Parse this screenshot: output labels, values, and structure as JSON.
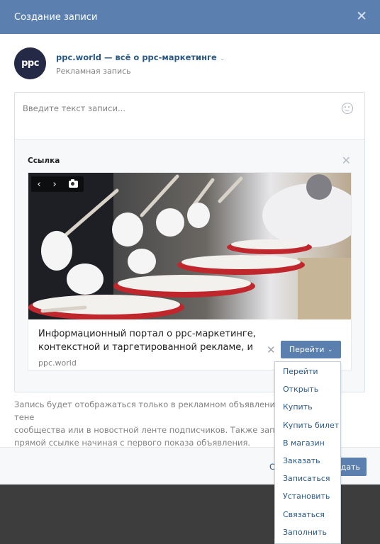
{
  "modal": {
    "title": "Создание записи",
    "close_icon": "close-icon"
  },
  "author": {
    "avatar_text": "ppc",
    "name": "ppc.world — всё о ppc-маркетинге",
    "subtitle": "Рекламная запись"
  },
  "editor": {
    "placeholder": "Введите текст записи...",
    "emoji_icon": "smile-icon"
  },
  "attachment": {
    "label": "Ссылка",
    "card": {
      "title": "Информационный портал о ppc-маркетинге, контекстной и таргетированной рекламе, и",
      "domain": "ppc.world",
      "button_label": "Перейти"
    },
    "photo_controls": [
      "prev-icon",
      "next-icon",
      "camera-icon"
    ]
  },
  "note": {
    "line1": "Запись будет отображаться только в рекламном объявлении и не",
    "line1_end": "тене",
    "line2": "сообщества или в новостной ленте подписчиков. Также запись ст",
    "line3": "прямой ссылке начиная с первого показа объявления."
  },
  "footer": {
    "cancel_partial": "С",
    "submit_partial": "дать"
  },
  "dropdown": {
    "items": [
      "Перейти",
      "Открыть",
      "Купить",
      "Купить билет",
      "В магазин",
      "Заказать",
      "Записаться",
      "Установить",
      "Связаться",
      "Заполнить"
    ]
  },
  "colors": {
    "header": "#5b80b0",
    "link": "#2a5885",
    "muted": "#828282"
  }
}
